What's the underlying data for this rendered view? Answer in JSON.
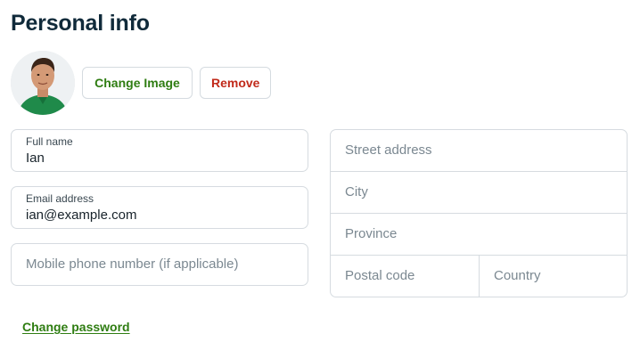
{
  "header": {
    "title": "Personal info"
  },
  "profile_image": {
    "change_label": "Change Image",
    "remove_label": "Remove"
  },
  "personal": {
    "full_name": {
      "label": "Full name",
      "value": "Ian"
    },
    "email": {
      "label": "Email address",
      "value": "ian@example.com"
    },
    "mobile": {
      "placeholder": "Mobile phone number (if applicable)"
    }
  },
  "address": {
    "street": {
      "placeholder": "Street address"
    },
    "city": {
      "placeholder": "City"
    },
    "province": {
      "placeholder": "Province"
    },
    "postal_code": {
      "placeholder": "Postal code"
    },
    "country": {
      "placeholder": "Country"
    }
  },
  "links": {
    "change_password": "Change password"
  },
  "colors": {
    "accent_green": "#2f7d12",
    "danger_red": "#c12a1a",
    "title_navy": "#102a3a",
    "border": "#d6dbe0"
  },
  "icons": {
    "avatar": "user-avatar-photo"
  }
}
